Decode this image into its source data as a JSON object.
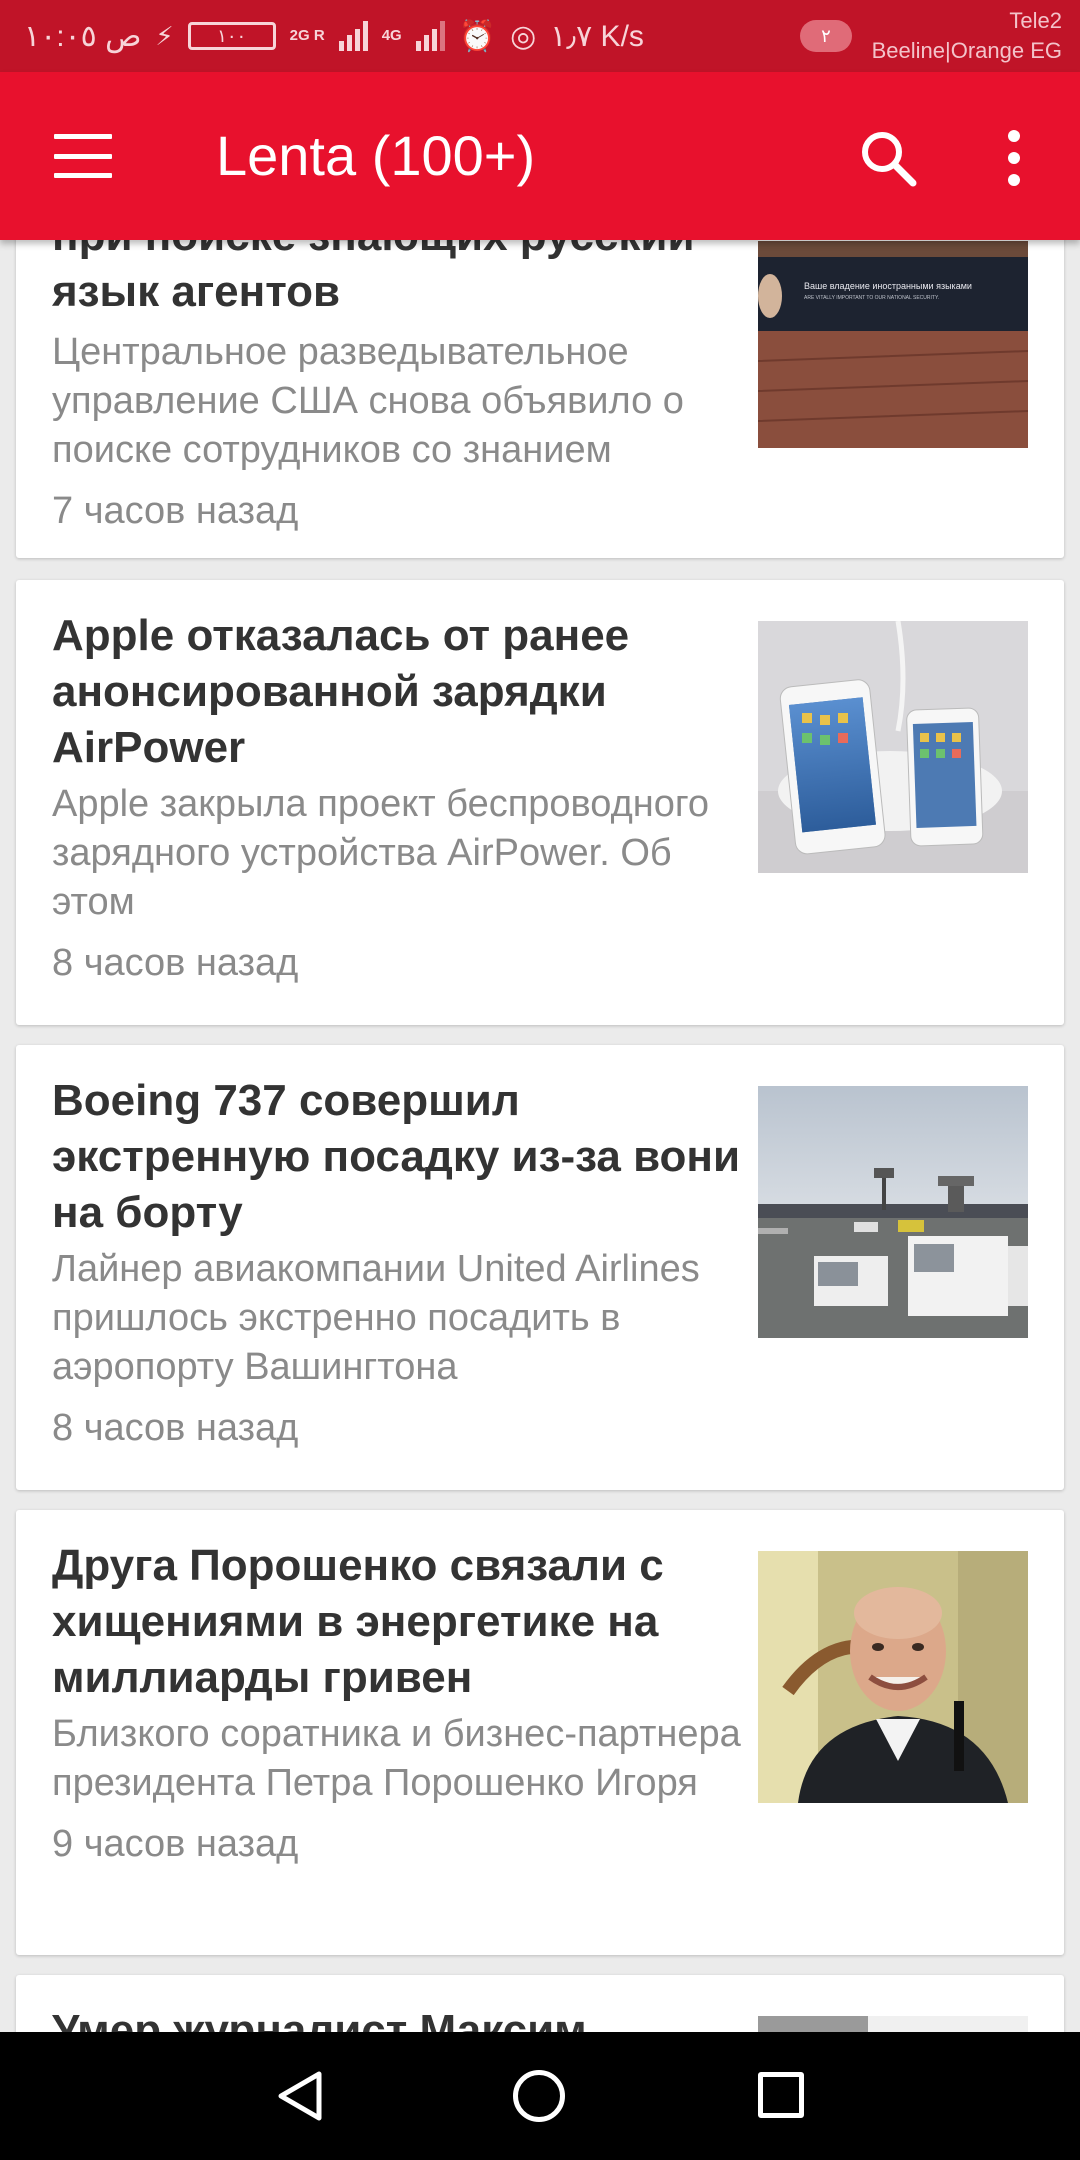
{
  "status_bar": {
    "time": "ص ١٠:٠٥",
    "battery": "١٠٠",
    "net1": "2G R",
    "net2": "4G",
    "speed": "١٫٧ K/s",
    "sim_badge": "٢",
    "carrier1": "Tele2",
    "carrier2": "Beeline|Orange EG"
  },
  "toolbar": {
    "title": "Lenta (100+)",
    "menu_icon": "hamburger-menu-icon",
    "search_icon": "search-icon",
    "overflow_icon": "more-vert-icon"
  },
  "articles": [
    {
      "headline": "при поиске знающих русский язык агентов",
      "snippet": "Центральное разведывательное управление США снова объявило о поиске сотрудников со знанием",
      "time": "7 часов назад",
      "image": "cia-advert-photo",
      "image_caption": "Ваше владение иностранными языками",
      "image_caption2": "ARE VITALLY IMPORTANT TO OUR NATIONAL SECURITY."
    },
    {
      "headline": "Apple отказалась от ранее анонсированной зарядки AirPower",
      "snippet": "Apple закрыла проект беспроводного зарядного устройства AirPower. Об этом",
      "time": "8 часов назад",
      "image": "iphones-airpower-photo"
    },
    {
      "headline": "Boeing 737 совершил экстренную посадку из-за вони на борту",
      "snippet": "Лайнер авиакомпании United Airlines пришлось экстренно посадить в аэропорту Вашингтона",
      "time": "8 часов назад",
      "image": "airport-photo"
    },
    {
      "headline": "Друга Порошенко связали с хищениями в энергетике на миллиарды гривен",
      "snippet": "Близкого соратника и бизнес-партнера президента Петра Порошенко Игоря",
      "time": "9 часов назад",
      "image": "man-portrait-photo"
    },
    {
      "headline": "Умер журналист Максим",
      "image": "partial-photo"
    }
  ],
  "nav_bar": {
    "back_icon": "back-triangle-icon",
    "home_icon": "home-circle-icon",
    "recents_icon": "recents-square-icon"
  },
  "colors": {
    "toolbar": "#e8112d",
    "status_bar": "#c01428",
    "headline": "#333333",
    "snippet": "#8a8a8a"
  }
}
